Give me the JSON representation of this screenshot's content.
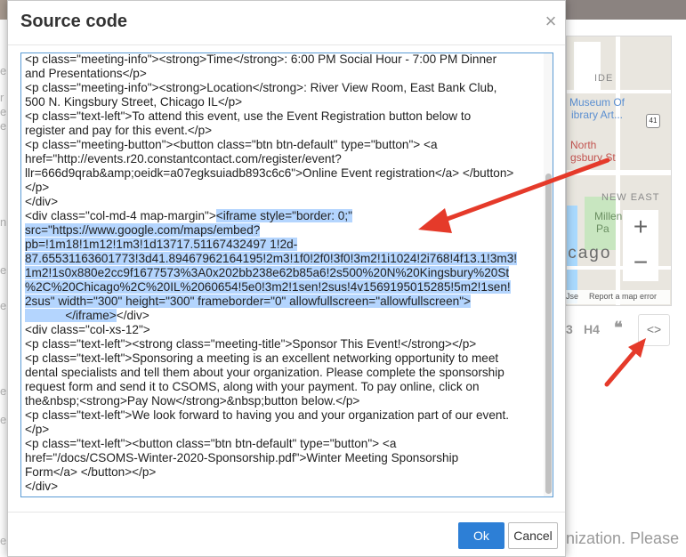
{
  "background": {
    "left_fragments": [
      "e",
      "r",
      "e",
      "e",
      "n",
      "e",
      "e",
      "e",
      "e",
      "e"
    ],
    "bottom_right_text": "nization. Please"
  },
  "map": {
    "labels": {
      "ide": "IDE",
      "museum": "Museum Of",
      "library": "ibrary Art...",
      "north": "North",
      "kingsbury": "gsbury St",
      "new_east": "NEW EAST",
      "millennium_1": "Millen",
      "millennium_2": "Pa",
      "chicago": "icago",
      "shield": "41",
      "use": "Jse",
      "report": "Report a map error"
    },
    "zoom_in": "+",
    "zoom_out": "−"
  },
  "editor_toolbar": {
    "h3": "3",
    "h4": "H4",
    "quote": "❝",
    "code": "<>"
  },
  "modal": {
    "title": "Source code",
    "close": "×",
    "code_before": "<p class=\"meeting-info\"><strong>Time</strong>: 6:00 PM Social Hour - 7:00 PM Dinner\nand Presentations</p>\n<p class=\"meeting-info\"><strong>Location</strong>: River View Room, East Bank Club,\n500 N. Kingsbury Street, Chicago IL</p>\n<p class=\"text-left\">To attend this event, use the Event Registration button below to\nregister and pay for this event.</p>\n<p class=\"meeting-button\"><button class=\"btn btn-default\" type=\"button\"> <a\nhref=\"http://events.r20.constantcontact.com/register/event?\nllr=666d9qrab&amp;oeidk=a07egksuiadb893c6c6\">Online Event registration</a> </button>\n</p>\n</div>\n<div class=\"col-md-4 map-margin\">",
    "code_selected": "<iframe style=\"border: 0;\"\nsrc=\"https://www.google.com/maps/embed?\npb=!1m18!1m12!1m3!1d13717.51167432497 1!2d-\n87.65531163601773!3d41.89467962164195!2m3!1f0!2f0!3f0!3m2!1i1024!2i768!4f13.1!3m3!\n1m2!1s0x880e2cc9f1677573%3A0x202bb238e62b85a6!2s500%20N%20Kingsbury%20St\n%2C%20Chicago%2C%20IL%2060654!5e0!3m2!1sen!2sus!4v1569195015285!5m2!1sen!\n2sus\" width=\"300\" height=\"300\" frameborder=\"0\" allowfullscreen=\"allowfullscreen\">\n            </iframe>",
    "code_after": "</div>\n<div class=\"col-xs-12\">\n<p class=\"text-left\"><strong class=\"meeting-title\">Sponsor This Event!</strong></p>\n<p class=\"text-left\">Sponsoring a meeting is an excellent networking opportunity to meet\ndental specialists and tell them about your organization. Please complete the sponsorship\nrequest form and send it to CSOMS, along with your payment. To pay online, click on\nthe&nbsp;<strong>Pay Now</strong>&nbsp;button below.</p>\n<p class=\"text-left\">We look forward to having you and your organization part of our event.\n</p>\n<p class=\"text-left\"><button class=\"btn btn-default\" type=\"button\"> <a\nhref=\"/docs/CSOMS-Winter-2020-Sponsorship.pdf\">Winter Meeting Sponsorship\nForm</a> </button></p>\n</div>",
    "ok_label": "Ok",
    "cancel_label": "Cancel"
  },
  "colors": {
    "selection": "#b4d5fe",
    "ok_button": "#2d7fd6",
    "arrow": "#e53a2a",
    "textarea_border": "#5b9bd5"
  }
}
